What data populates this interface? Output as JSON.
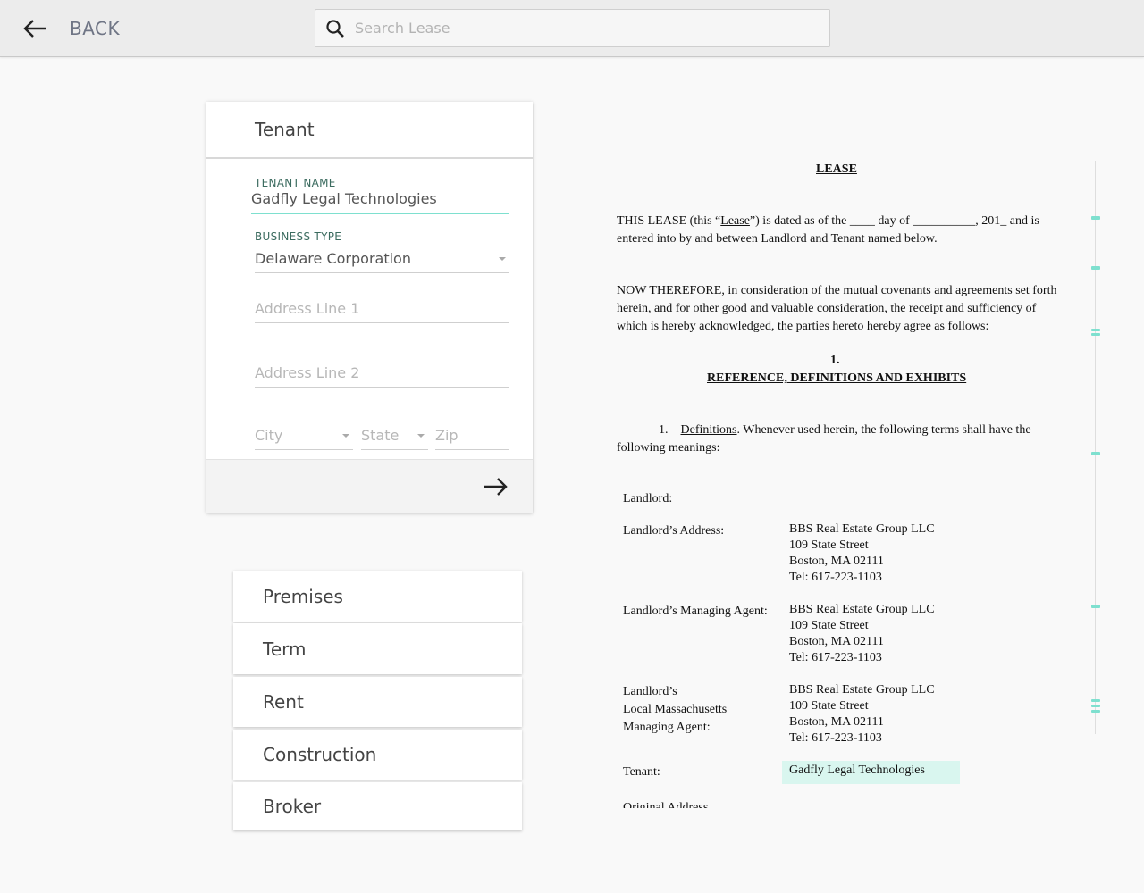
{
  "topbar": {
    "back_label": "BACK",
    "search_placeholder": "Search Lease"
  },
  "tenant_card": {
    "title": "Tenant",
    "tenant_name_label": "TENANT NAME",
    "tenant_name_value": "Gadfly Legal Technologies",
    "business_type_label": "BUSINESS TYPE",
    "business_type_value": "Delaware Corporation",
    "address1_placeholder": "Address Line 1",
    "address2_placeholder": "Address Line 2",
    "city_placeholder": "City",
    "state_placeholder": "State",
    "zip_placeholder": "Zip"
  },
  "sections": [
    "Premises",
    "Term",
    "Rent",
    "Construction",
    "Broker"
  ],
  "document": {
    "heading": "LEASE",
    "intro_1_pre": "THIS LEASE (this “",
    "intro_1_link": "Lease",
    "intro_1_post": "”) is dated as of the ____ day of __________, 201_ and is",
    "intro_2": "entered into by and between Landlord and Tenant named below.",
    "now_1": "NOW THEREFORE, in consideration of the mutual covenants and agreements set forth",
    "now_2": "herein, and for other good and valuable consideration, the receipt and sufficiency of",
    "now_3": "which is hereby acknowledged, the parties hereto hereby agree as follows:",
    "section_number": "1.",
    "section_title": "REFERENCE, DEFINITIONS AND EXHIBITS",
    "def_number": "1.",
    "def_term": "Definitions",
    "def_text": ".  Whenever used herein, the following terms shall have the",
    "def_text_2": "following meanings:",
    "landlord_label": "Landlord:",
    "landlord_address_label": "Landlord’s Address:",
    "landlord_address": [
      "BBS Real Estate Group LLC",
      "109 State Street",
      "Boston, MA 02111",
      "Tel: 617-223-1103"
    ],
    "managing_agent_label": "Landlord’s Managing Agent:",
    "managing_agent": [
      "BBS Real Estate Group LLC",
      "109 State Street",
      "Boston, MA 02111",
      "Tel: 617-223-1103"
    ],
    "local_agent_label": [
      "Landlord’s",
      "Local Massachusetts",
      "Managing Agent:"
    ],
    "local_agent": [
      "BBS Real Estate Group LLC",
      "109 State Street",
      "Boston, MA 02111",
      "Tel: 617-223-1103"
    ],
    "tenant_label": "Tenant:",
    "tenant_value": "Gadfly Legal Technologies",
    "original_address_label": "Original Address"
  },
  "colors": {
    "accent": "#7ee0cf",
    "label_green": "#3b6b5f",
    "highlight": "#d9f6ef"
  }
}
